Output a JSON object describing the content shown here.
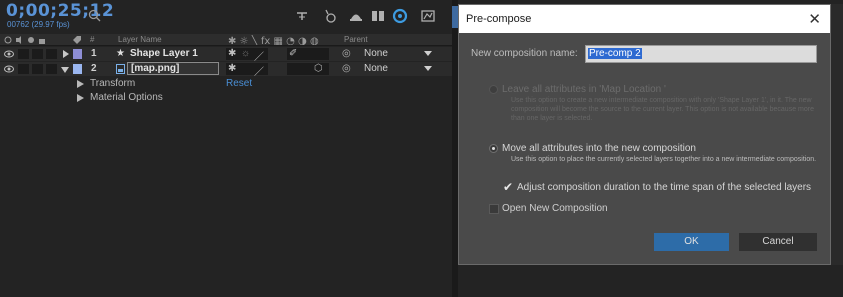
{
  "timeline": {
    "timecode": "0;00;25;12",
    "timecode_sub": "00762 (29.97 fps)",
    "search_placeholder": "",
    "header": {
      "num": "#",
      "layer_name": "Layer Name",
      "parent": "Parent"
    },
    "layers": [
      {
        "index": "1",
        "name": "Shape Layer 1",
        "parent": "None",
        "color": "#8f8fd6"
      },
      {
        "index": "2",
        "name": "[map.png]",
        "parent": "None",
        "color": "#9ab6f0"
      }
    ],
    "properties": [
      {
        "name": "Transform",
        "value": "Reset"
      },
      {
        "name": "Material Options",
        "value": ""
      }
    ]
  },
  "dialog": {
    "title": "Pre-compose",
    "name_label": "New composition name:",
    "name_value": "Pre-comp 2",
    "options": [
      {
        "label": "Leave all attributes in 'Map Location '",
        "description": "Use this option to create a new intermediate composition with only 'Shape Layer 1', in it. The new composition will become the source to the current layer. This option is not available because more than one layer is selected.",
        "enabled": false,
        "selected": false
      },
      {
        "label": "Move all attributes into the new composition",
        "description": "Use this option to place the currently selected layers together into a new intermediate composition.",
        "enabled": true,
        "selected": true
      }
    ],
    "adjust_duration_label": "Adjust composition duration to the time span of the selected layers",
    "adjust_duration_checked": true,
    "open_new_label": "Open New Composition",
    "open_new_checked": false,
    "ok_label": "OK",
    "cancel_label": "Cancel"
  },
  "colors": {
    "accent": "#2d6ca8",
    "timecode": "#5a93d6",
    "selection": "#2e6ad1"
  }
}
